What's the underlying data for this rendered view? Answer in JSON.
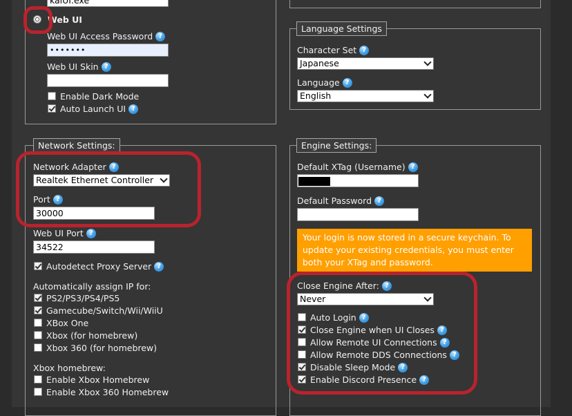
{
  "top_fields": {
    "exe_value": "kaiUI.exe"
  },
  "webui": {
    "mode_label": "Web UI",
    "password_label": "Web UI Access Password",
    "password_value": "•••••••",
    "skin_label": "Web UI Skin",
    "skin_value": "",
    "dark_mode_label": "Enable Dark Mode",
    "dark_mode_checked": false,
    "auto_launch_label": "Auto Launch UI",
    "auto_launch_checked": true
  },
  "language": {
    "legend": "Language Settings",
    "charset_label": "Character Set",
    "charset_value": "Japanese",
    "language_label": "Language",
    "language_value": "English"
  },
  "network": {
    "legend": "Network Settings:",
    "adapter_label": "Network Adapter",
    "adapter_value": "Realtek Ethernet Controller",
    "port_label": "Port",
    "port_value": "30000",
    "webui_port_label": "Web UI Port",
    "webui_port_value": "34522",
    "proxy_label": "Autodetect Proxy Server",
    "assign_heading": "Automatically assign IP for:",
    "assign_items": [
      {
        "label": "PS2/PS3/PS4/PS5",
        "checked": true
      },
      {
        "label": "Gamecube/Switch/Wii/WiiU",
        "checked": true
      },
      {
        "label": "XBox One",
        "checked": false
      },
      {
        "label": "Xbox (for homebrew)",
        "checked": false
      },
      {
        "label": "Xbox 360 (for homebrew)",
        "checked": false
      }
    ],
    "homebrew_heading": "Xbox homebrew:",
    "homebrew_items": [
      {
        "label": "Enable Xbox Homebrew",
        "checked": false
      },
      {
        "label": "Enable Xbox 360 Homebrew",
        "checked": false
      }
    ]
  },
  "engine": {
    "legend": "Engine Settings:",
    "xtag_label": "Default XTag (Username)",
    "password_label": "Default Password",
    "notice": "Your login is now stored in a secure keychain. To update your existing credentials, you must enter both your XTag and password.",
    "close_after_label": "Close Engine After:",
    "close_after_value": "Never",
    "options": [
      {
        "label": "Auto Login",
        "checked": false
      },
      {
        "label": "Close Engine when UI Closes",
        "checked": true
      },
      {
        "label": "Allow Remote UI Connections",
        "checked": false
      },
      {
        "label": "Allow Remote DDS Connections",
        "checked": false
      },
      {
        "label": "Disable Sleep Mode",
        "checked": true
      },
      {
        "label": "Enable Discord Presence",
        "checked": true
      }
    ]
  },
  "colors": {
    "highlight": "#b8232d",
    "notice_bg": "#ff9f00",
    "help_icon": "#2a8ad8"
  }
}
